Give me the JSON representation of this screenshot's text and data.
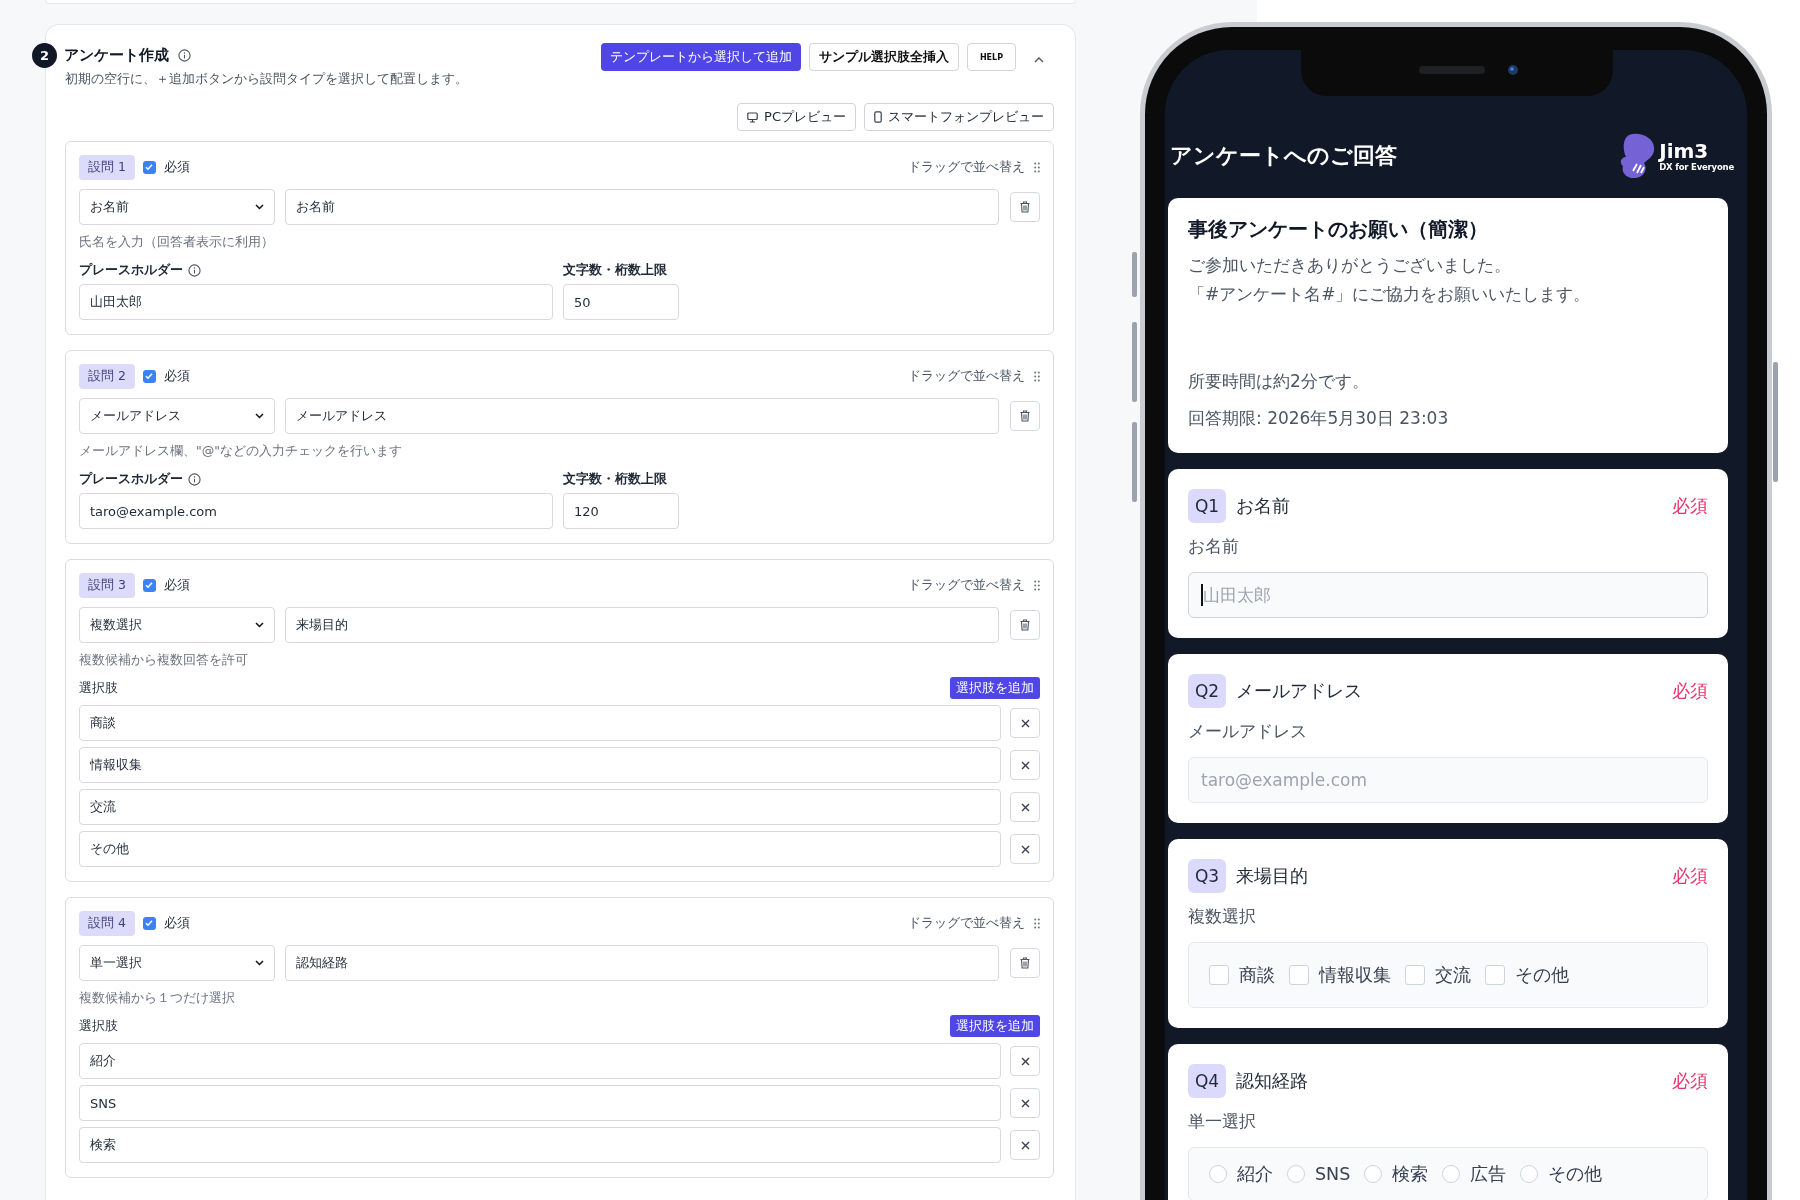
{
  "section": {
    "number": "2",
    "title": "アンケート作成",
    "description": "初期の空行に、＋追加ボタンから設問タイプを選択して配置します。",
    "expanded": true,
    "actions": [
      {
        "label": "テンプレートから選択して追加",
        "kind": "primary"
      },
      {
        "label": "サンプル選択肢全挿入",
        "kind": "secondary"
      },
      {
        "label": "HELP",
        "kind": "small"
      }
    ],
    "preview_buttons": [
      {
        "label": "PCプレビュー",
        "kind": "desktop"
      },
      {
        "label": "スマートフォンプレビュー",
        "kind": "phone"
      }
    ]
  },
  "questions": [
    {
      "badge": "設問 1",
      "required": true,
      "required_label": "必須",
      "drag_label": "ドラッグで並べ替え",
      "type": "お名前",
      "title": "お名前",
      "hint": "氏名を入力（回答者表示に利用）",
      "kind": "text",
      "placeholder_label": "プレースホルダー",
      "placeholder_setting": "山田太郎",
      "limit_label": "文字数・桁数上限",
      "limit_value": "50"
    },
    {
      "badge": "設問 2",
      "required": true,
      "required_label": "必須",
      "drag_label": "ドラッグで並べ替え",
      "type": "メールアドレス",
      "title": "メールアドレス",
      "hint": "メールアドレス欄、\"@\"などの入力チェックを行います",
      "kind": "text",
      "placeholder_label": "プレースホルダー",
      "placeholder_setting": "taro@example.com",
      "limit_label": "文字数・桁数上限",
      "limit_value": "120"
    },
    {
      "badge": "設問 3",
      "required": true,
      "required_label": "必須",
      "drag_label": "ドラッグで並べ替え",
      "type": "複数選択",
      "title": "来場目的",
      "hint": "複数候補から複数回答を許可",
      "kind": "choice",
      "options_label": "選択肢",
      "add_option": "選択肢を追加",
      "options": [
        "商談",
        "情報収集",
        "交流",
        "その他"
      ]
    },
    {
      "badge": "設問 4",
      "required": true,
      "required_label": "必須",
      "drag_label": "ドラッグで並べ替え",
      "type": "単一選択",
      "title": "認知経路",
      "hint": "複数候補から１つだけ選択",
      "kind": "choice",
      "options_label": "選択肢",
      "add_option": "選択肢を追加",
      "options": [
        "紹介",
        "SNS",
        "検索"
      ]
    }
  ],
  "phone": {
    "header": "アンケートへのご回答",
    "logo": {
      "name": "Jim3",
      "tagline": "DX for Everyone"
    },
    "intro": {
      "title": "事後アンケートのお願い（簡潔）",
      "lines": [
        "ご参加いただきありがとうございました。",
        "「#アンケート名#」にご協力をお願いいたします。"
      ],
      "duration": "所要時間は約2分です。",
      "deadline": "回答期限: 2026年5月30日 23:03"
    },
    "questions": [
      {
        "number": "Q1",
        "title": "お名前",
        "required": true,
        "required_label": "必須",
        "subtitle": "お名前",
        "kind": "text",
        "placeholder": "山田太郎",
        "focused": true
      },
      {
        "number": "Q2",
        "title": "メールアドレス",
        "required": true,
        "required_label": "必須",
        "subtitle": "メールアドレス",
        "kind": "text",
        "placeholder": "taro@example.com",
        "focused": false
      },
      {
        "number": "Q3",
        "title": "来場目的",
        "required": true,
        "required_label": "必須",
        "subtitle": "複数選択",
        "kind": "checkbox",
        "options": [
          {
            "label": "商談",
            "checked": false
          },
          {
            "label": "情報収集",
            "checked": false
          },
          {
            "label": "交流",
            "checked": false
          },
          {
            "label": "その他",
            "checked": false
          }
        ]
      },
      {
        "number": "Q4",
        "title": "認知経路",
        "required": true,
        "required_label": "必須",
        "subtitle": "単一選択",
        "kind": "radio",
        "options": [
          {
            "label": "紹介",
            "selected": false
          },
          {
            "label": "SNS",
            "selected": false
          },
          {
            "label": "検索",
            "selected": false
          },
          {
            "label": "広告",
            "selected": false
          },
          {
            "label": "その他",
            "selected": false
          }
        ]
      }
    ]
  }
}
